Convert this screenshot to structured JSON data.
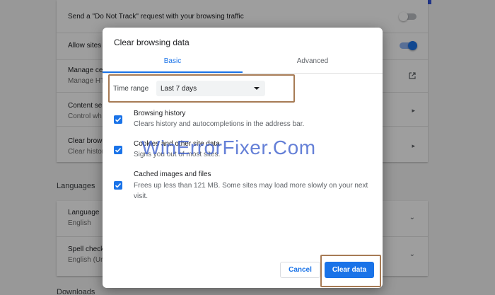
{
  "background": {
    "rows": [
      {
        "title": "Send a \"Do Not Track\" request with your browsing traffic",
        "subtitle": ""
      },
      {
        "title": "Allow sites",
        "subtitle": ""
      },
      {
        "title": "Manage ce",
        "subtitle": "Manage HT"
      },
      {
        "title": "Content se",
        "subtitle": "Control wh"
      },
      {
        "title": "Clear brows",
        "subtitle": "Clear histor"
      }
    ],
    "languages_heading": "Languages",
    "language_rows": [
      {
        "title": "Language",
        "subtitle": "English"
      },
      {
        "title": "Spell check",
        "subtitle": "English (Ur"
      }
    ],
    "downloads_heading": "Downloads"
  },
  "dialog": {
    "title": "Clear browsing data",
    "tabs": [
      {
        "label": "Basic",
        "selected": true
      },
      {
        "label": "Advanced",
        "selected": false
      }
    ],
    "time_range": {
      "label": "Time range",
      "value": "Last 7 days"
    },
    "items": [
      {
        "title": "Browsing history",
        "description": "Clears history and autocompletions in the address bar.",
        "checked": true
      },
      {
        "title": "Cookies and other site data",
        "description": "Signs you out of most sites.",
        "checked": true
      },
      {
        "title": "Cached images and files",
        "description": "Frees up less than 121 MB. Some sites may load more slowly on your next visit.",
        "checked": true
      }
    ],
    "cancel_label": "Cancel",
    "clear_label": "Clear data"
  },
  "watermark": "WinErrorFixer.Com",
  "colors": {
    "accent": "#1a73e8",
    "highlight": "#a77b55",
    "top_bar": "#3455db"
  }
}
